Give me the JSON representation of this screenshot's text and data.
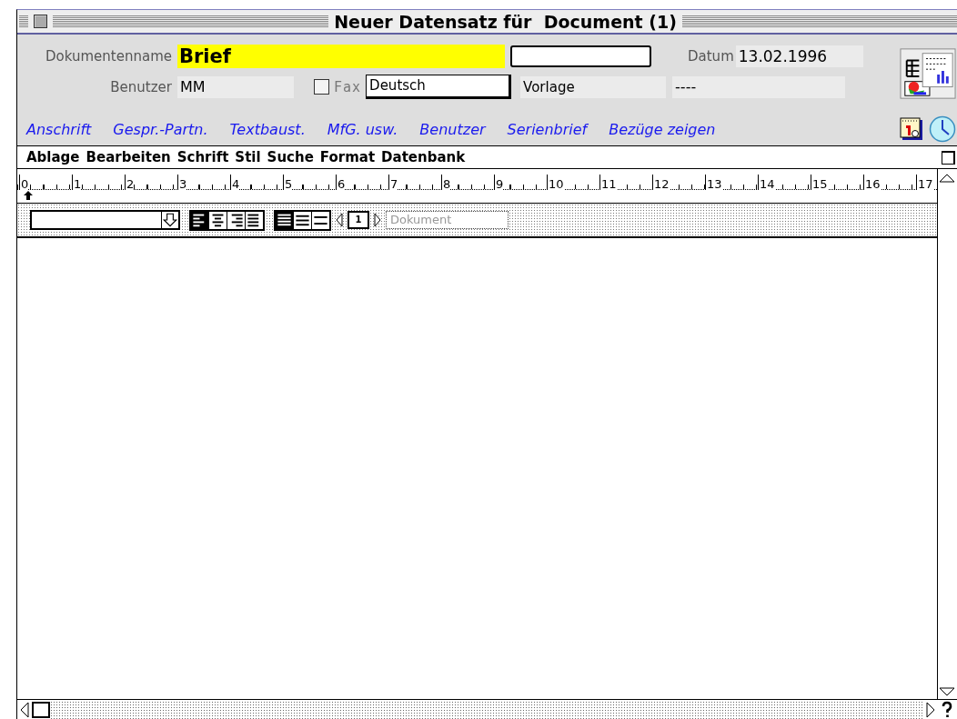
{
  "window": {
    "title": "Neuer Datensatz für  Document (1)"
  },
  "form": {
    "document_name": {
      "label": "Dokumentenname",
      "value": "Brief"
    },
    "date": {
      "label": "Datum",
      "value": "13.02.1996"
    },
    "user": {
      "label": "Benutzer",
      "value": "MM"
    },
    "fax": {
      "label": "Fax",
      "checked": false,
      "disabled": true
    },
    "language": {
      "value": "Deutsch"
    },
    "template": {
      "value": "Vorlage"
    },
    "template_code": {
      "value": "----"
    }
  },
  "links": [
    "Anschrift",
    "Gespr.-Partn.",
    "Textbaust.",
    "MfG. usw.",
    "Benutzer",
    "Serienbrief",
    "Bezüge zeigen"
  ],
  "menu": [
    "Ablage",
    "Bearbeiten",
    "Schrift",
    "Stil",
    "Suche",
    "Format",
    "Datenbank"
  ],
  "ruler": [
    "0",
    "1",
    "2",
    "3",
    "4",
    "5",
    "6",
    "7",
    "8",
    "9",
    "10",
    "11",
    "12",
    "13",
    "14",
    "15",
    "16",
    "17"
  ],
  "toolbar": {
    "alignment": [
      {
        "kind": "left",
        "selected": true
      },
      {
        "kind": "center",
        "selected": false
      },
      {
        "kind": "right",
        "selected": false
      },
      {
        "kind": "justify",
        "selected": false
      }
    ],
    "spacing": [
      {
        "kind": "single",
        "selected": true
      },
      {
        "kind": "double",
        "selected": false
      },
      {
        "kind": "wide",
        "selected": false
      }
    ],
    "page": "1",
    "view": {
      "value": "Dokument",
      "disabled": true
    }
  }
}
